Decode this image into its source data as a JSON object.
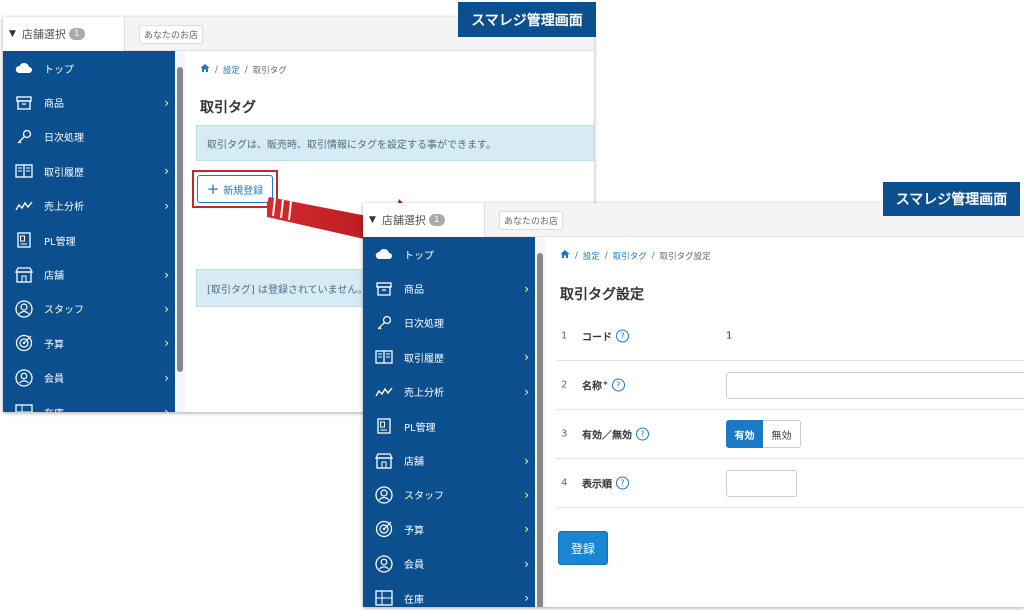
{
  "labels": {
    "back": "スマレジ管理画面",
    "front": "スマレジ管理画面"
  },
  "header": {
    "store_select": "店舗選択",
    "store_count": "1",
    "store_name": "あなたのお店"
  },
  "sidebar": {
    "items": [
      {
        "label": "トップ",
        "icon": "cloud-icon",
        "chevron": false
      },
      {
        "label": "商品",
        "icon": "box-icon",
        "chevron": true
      },
      {
        "label": "日次処理",
        "icon": "key-icon",
        "chevron": false
      },
      {
        "label": "取引履歴",
        "icon": "book-icon",
        "chevron": true
      },
      {
        "label": "売上分析",
        "icon": "chart-line-icon",
        "chevron": true
      },
      {
        "label": "PL管理",
        "icon": "document-icon",
        "chevron": false
      },
      {
        "label": "店舗",
        "icon": "store-icon",
        "chevron": true
      },
      {
        "label": "スタッフ",
        "icon": "user-icon",
        "chevron": true
      },
      {
        "label": "予算",
        "icon": "target-icon",
        "chevron": true
      },
      {
        "label": "会員",
        "icon": "member-icon",
        "chevron": true
      },
      {
        "label": "在庫",
        "icon": "grid-icon",
        "chevron": true
      }
    ]
  },
  "back_page": {
    "breadcrumb": {
      "settings": "設定",
      "current": "取引タグ"
    },
    "title": "取引タグ",
    "info": "取引タグは、販売時、取引情報にタグを設定する事ができます。",
    "new_button": "新規登録",
    "empty_message": "[取引タグ] は登録されていません。"
  },
  "front_page": {
    "breadcrumb": {
      "settings": "設定",
      "tag": "取引タグ",
      "current": "取引タグ設定"
    },
    "title": "取引タグ設定",
    "rows": [
      {
        "num": "1",
        "label": "コード",
        "value": "1"
      },
      {
        "num": "2",
        "label": "名称"
      },
      {
        "num": "3",
        "label": "有効／無効",
        "on": "有効",
        "off": "無効"
      },
      {
        "num": "4",
        "label": "表示順"
      }
    ],
    "required_mark": "*",
    "help": "?",
    "submit": "登録"
  },
  "colors": {
    "sidebar": "#0b4f8e",
    "accent": "#1c7ac4",
    "highlight": "#c2272d"
  }
}
